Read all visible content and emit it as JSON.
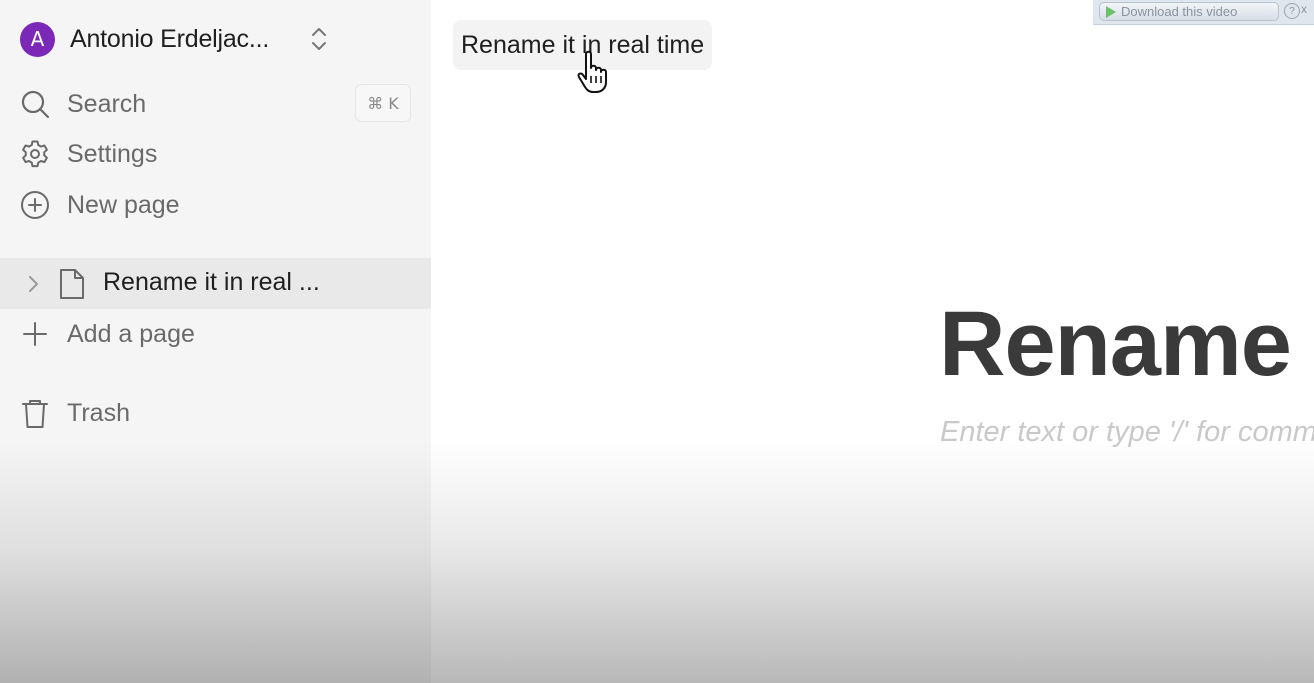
{
  "workspace": {
    "avatar_letter": "A",
    "name": "Antonio Erdeljac...",
    "avatar_color": "#7b27b8"
  },
  "nav": {
    "search_label": "Search",
    "search_shortcut": "⌘ K",
    "settings_label": "Settings",
    "new_page_label": "New page"
  },
  "pages": [
    {
      "label": "Rename it in real ...",
      "icon": "file-icon"
    }
  ],
  "add_page_label": "Add a page",
  "trash_label": "Trash",
  "main": {
    "breadcrumb_title": "Rename it in real time",
    "page_title": "Rename it in real time",
    "editor_placeholder": "Enter text or type '/' for commands"
  },
  "overlay": {
    "download_label": "Download this video",
    "help_label": "?",
    "close_label": "x"
  }
}
